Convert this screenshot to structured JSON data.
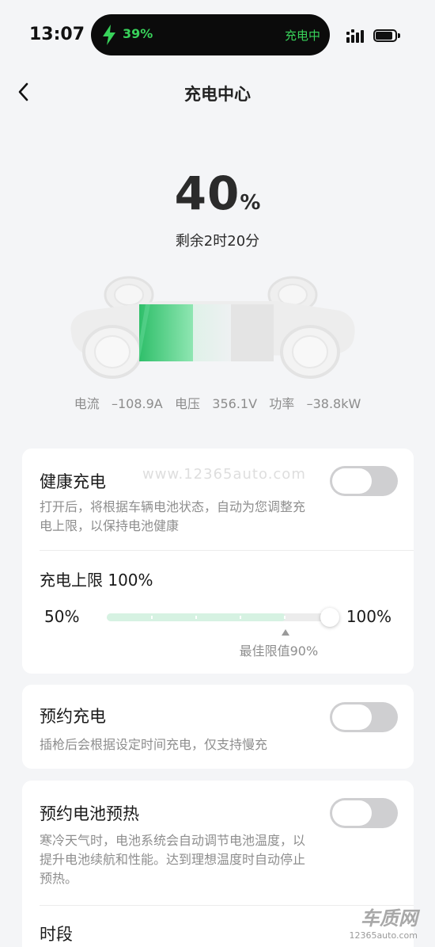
{
  "status_bar": {
    "time": "13:07",
    "island_percent": "39%",
    "island_status": "充电中",
    "signal_icon": "signal-bars-icon",
    "battery_icon": "battery-icon"
  },
  "header": {
    "title": "充电中心",
    "back_icon": "chevron-left-icon"
  },
  "battery": {
    "soc_value": "40",
    "soc_unit": "%",
    "remaining": "剩余2时20分",
    "level": 0.4,
    "stats": {
      "current_label": "电流",
      "current_value": "–108.9A",
      "voltage_label": "电压",
      "voltage_value": "356.1V",
      "power_label": "功率",
      "power_value": "–38.8kW"
    }
  },
  "healthy_charge": {
    "title": "健康充电",
    "desc": "打开后，将根据车辆电池状态，自动为您调整充电上限，以保持电池健康",
    "toggle_on": false
  },
  "charge_limit": {
    "label": "充电上限 100%",
    "min_label": "50%",
    "max_label": "100%",
    "value_percent": 100,
    "best_label": "最佳限值90%",
    "best_percent": 90
  },
  "scheduled_charge": {
    "title": "预约充电",
    "desc": "插枪后会根据设定时间充电，仅支持慢充",
    "toggle_on": false
  },
  "preheat": {
    "title": "预约电池预热",
    "desc": "寒冷天气时，电池系统会自动调节电池温度，以提升电池续航和性能。达到理想温度时自动停止预热。",
    "toggle_on": false,
    "period_label": "时段"
  },
  "watermark": "www.12365auto.com",
  "logo": {
    "main": "车质网",
    "sub": "12365auto.com"
  },
  "colors": {
    "accent_green": "#38d25a",
    "battery_green": "#3fcf7a",
    "toggle_off": "#cfcfd1",
    "background": "#f4f5f7"
  }
}
